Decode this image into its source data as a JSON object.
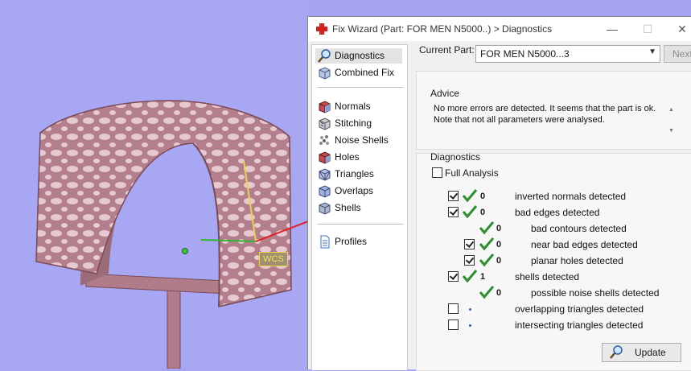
{
  "viewport": {
    "wcs_label": "WCS"
  },
  "window": {
    "title": "Fix Wizard (Part: FOR MEN N5000..) > Diagnostics",
    "controls": {
      "minimize": "—",
      "maximize": "☐",
      "close": "✕"
    }
  },
  "nav": {
    "items": [
      {
        "label": "Diagnostics",
        "icon": "magnifier-icon",
        "selected": true
      },
      {
        "label": "Combined Fix",
        "icon": "combined-fix-icon"
      },
      {
        "label": "Normals",
        "icon": "normals-cube-icon"
      },
      {
        "label": "Stitching",
        "icon": "stitching-cube-icon"
      },
      {
        "label": "Noise Shells",
        "icon": "noise-shells-icon"
      },
      {
        "label": "Holes",
        "icon": "holes-cube-icon"
      },
      {
        "label": "Triangles",
        "icon": "triangles-cube-icon"
      },
      {
        "label": "Overlaps",
        "icon": "overlaps-cube-icon"
      },
      {
        "label": "Shells",
        "icon": "shells-cube-icon"
      },
      {
        "label": "Profiles",
        "icon": "profiles-document-icon"
      }
    ]
  },
  "part": {
    "label": "Current Part:",
    "value": "FOR MEN N5000...3",
    "next_label": "Next"
  },
  "advice": {
    "title": "Advice",
    "text": "No more errors are detected. It seems that the part is ok. Note that not all parameters were analysed."
  },
  "diagnostics": {
    "title": "Diagnostics",
    "full_analysis_label": "Full Analysis",
    "rows": [
      {
        "count": "0",
        "label": "inverted normals detected",
        "checked": true
      },
      {
        "count": "0",
        "label": "bad edges detected",
        "checked": true
      },
      {
        "count": "0",
        "label": "bad contours detected"
      },
      {
        "count": "0",
        "label": "near bad edges detected",
        "checked": true
      },
      {
        "count": "0",
        "label": "planar holes detected",
        "checked": true
      },
      {
        "count": "1",
        "label": "shells detected",
        "checked": true
      },
      {
        "count": "0",
        "label": "possible noise shells detected"
      },
      {
        "label": "overlapping triangles detected",
        "checked": false
      },
      {
        "label": "intersecting triangles detected",
        "checked": false
      }
    ],
    "update_label": "Update"
  }
}
